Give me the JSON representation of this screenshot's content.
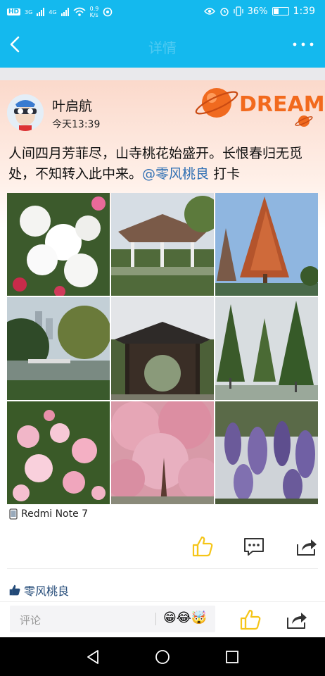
{
  "status": {
    "speed_value": "0.9",
    "speed_unit": "K/s",
    "battery": "36%",
    "battery_level": 0.36,
    "time": "1:39",
    "hd_label": "HD",
    "net1": "3G",
    "net2": "4G"
  },
  "appbar": {
    "title": "详情",
    "back_icon": "back-chevron-icon",
    "more_icon": "more-dots-icon"
  },
  "post": {
    "author": "叶启航",
    "time": "今天13:39",
    "banner_text": "DREAM",
    "text_main": "人间四月芳菲尽，山寺桃花始盛开。长恨春归无觅处，不知转入此中来。",
    "mention": "@零风桃良",
    "text_tail": " 打卡",
    "device": "Redmi Note 7",
    "photos": [
      "white-azalea-photo",
      "pavilion-photo",
      "red-cypress-photo",
      "pond-garden-photo",
      "round-gate-pavilion-photo",
      "cypress-row-photo",
      "pink-azalea-photo",
      "cherry-blossom-photo",
      "wisteria-photo"
    ]
  },
  "likes": {
    "users": "零风桃良"
  },
  "comment_bar": {
    "placeholder": "评论",
    "emoji": "😁😂🤯"
  },
  "colors": {
    "accent": "#14b9ee",
    "like_yellow": "#f5c518",
    "mention": "#2f6fb3"
  }
}
